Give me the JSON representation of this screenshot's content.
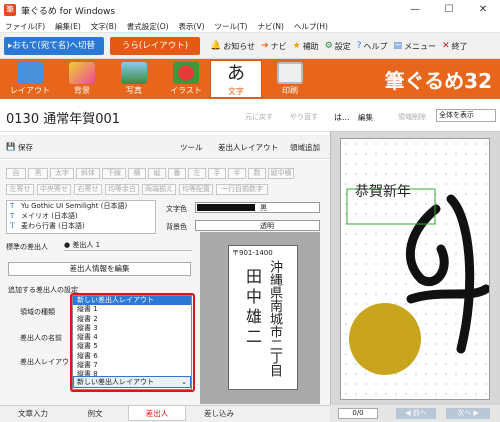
{
  "window": {
    "title": "筆ぐるめ for Windows",
    "minimize": "—",
    "maximize": "☐",
    "close": "✕"
  },
  "menu": [
    "ファイル(F)",
    "編集(E)",
    "文字(B)",
    "書式設定(O)",
    "表示(V)",
    "ツール(T)",
    "ナビ(N)",
    "ヘルプ(H)"
  ],
  "modes": {
    "omote": "▸おもて(宛て名)へ切替",
    "ura": "うら(レイアウト)"
  },
  "toolbar_links": [
    {
      "icon": "bell-icon",
      "glyph": "🔔",
      "label": "お知らせ"
    },
    {
      "icon": "navi-icon",
      "glyph": "➔",
      "label": "ナビ"
    },
    {
      "icon": "star-icon",
      "glyph": "★",
      "label": "補助"
    },
    {
      "icon": "gear-icon",
      "glyph": "⚙",
      "label": "設定"
    },
    {
      "icon": "help-icon",
      "glyph": "?",
      "label": "ヘルプ"
    },
    {
      "icon": "menu-icon",
      "glyph": "▤",
      "label": "メニュー"
    },
    {
      "icon": "exit-icon",
      "glyph": "✕",
      "label": "終了"
    }
  ],
  "ribbon_tabs": [
    "レイアウト",
    "背景",
    "写真",
    "イラスト",
    "文字",
    "印刷"
  ],
  "ribbon_active": "文字",
  "brand": "筆ぐるめ32",
  "document": {
    "name": "0130 通常年賀001",
    "undo": "元に戻す",
    "redo": "やり直す"
  },
  "toolrow": {
    "save": "保存",
    "tool": "ツール",
    "sender_layout": "差出人レイアウト",
    "add_area": "領域追加"
  },
  "style_buttons_row1": [
    "自",
    "黒",
    "太字",
    "斜体",
    "下線",
    "横",
    "縦",
    "番",
    "左",
    "手",
    "半",
    "数",
    "縦中横"
  ],
  "style_buttons_row2": [
    "左寄せ",
    "中央寄せ",
    "右寄せ",
    "均等余白",
    "両端揃え",
    "均等配置",
    "一行目揃数字"
  ],
  "fonts": [
    "Yu Gothic UI Semilight (日本語)",
    "メイリオ (日本語)",
    "麦わら行書 (日本語)"
  ],
  "text_color": {
    "label": "文字色",
    "value": "黒"
  },
  "bg_color": {
    "label": "背景色",
    "value": "透明"
  },
  "standard_sender": {
    "label": "標準の差出人",
    "value": "差出人 1"
  },
  "edit_sender_btn": "差出人情報を編集",
  "add_sender_section": "追加する差出人の設定",
  "field_labels": {
    "area_type": "領域の種類",
    "sender_name": "差出人の名前",
    "sender_layout": "差出人レイアウト"
  },
  "dropdown_options": [
    "新しい差出人レイアウト",
    "縦書 1",
    "縦書 2",
    "縦書 3",
    "縦書 4",
    "縦書 5",
    "縦書 6",
    "縦書 7",
    "縦書 8"
  ],
  "dropdown_selected": "新しい差出人レイアウト",
  "preview": {
    "postal": "〒901-1400",
    "address": "沖縄県南城市二丁目",
    "name": "田中雄二"
  },
  "bottom_tabs": [
    "文章入力",
    "例文",
    "差出人",
    "差し込み"
  ],
  "bottom_active": "差出人",
  "right_panel": {
    "title": "は...",
    "edit": "編集",
    "area_delete": "領域削除",
    "view": "全体を表示",
    "card_title": "恭賀新年",
    "page": "0/0",
    "prev": "前へ",
    "next": "次へ"
  }
}
